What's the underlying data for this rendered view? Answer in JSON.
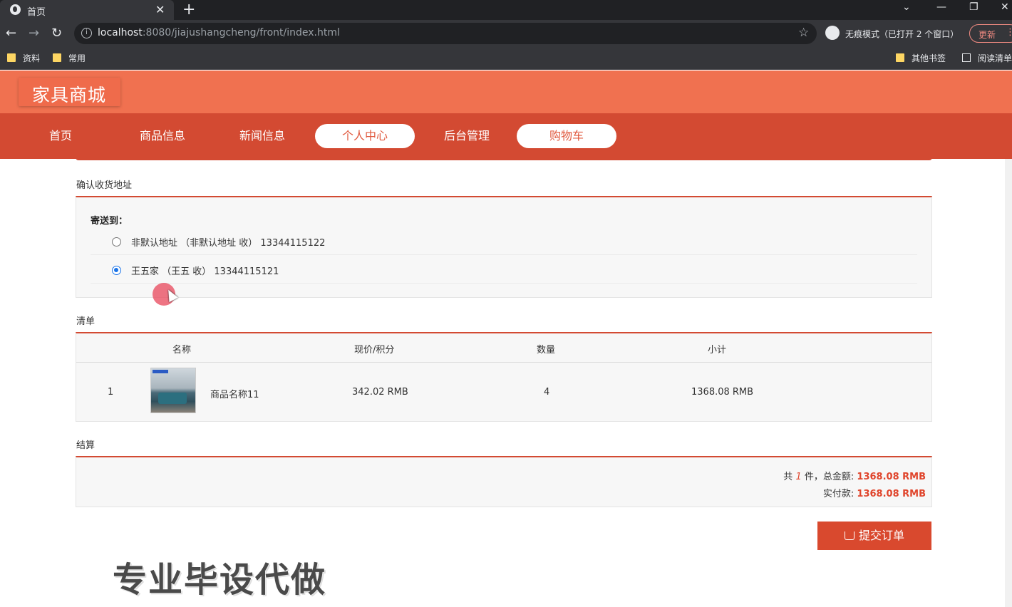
{
  "browser": {
    "tab_title": "首页",
    "url_host": "localhost",
    "url_rest": ":8080/jiajushangcheng/front/index.html",
    "incognito_label": "无痕模式（已打开 2 个窗口）",
    "update_label": "更新",
    "bookmarks": [
      "资料",
      "常用"
    ],
    "bookmarks_right": [
      "其他书签",
      "阅读清单"
    ]
  },
  "site": {
    "logo": "家具商城",
    "nav": [
      "首页",
      "商品信息",
      "新闻信息",
      "个人中心",
      "后台管理",
      "购物车"
    ]
  },
  "address": {
    "section_title": "确认收货地址",
    "ship_to_label": "寄送到：",
    "options": [
      {
        "text": "非默认地址 （非默认地址 收） 13344115122",
        "checked": false
      },
      {
        "text": "王五家 （王五 收） 13344115121",
        "checked": true
      }
    ]
  },
  "list": {
    "section_title": "清单",
    "headers": [
      "名称",
      "现价/积分",
      "数量",
      "小计"
    ],
    "rows": [
      {
        "index": "1",
        "name": "商品名称11",
        "price": "342.02 RMB",
        "qty": "4",
        "subtotal": "1368.08 RMB"
      }
    ]
  },
  "checkout": {
    "section_title": "结算",
    "total_prefix": "共",
    "total_count": "1",
    "total_mid": "件，总金额:",
    "total_amount": "1368.08 RMB",
    "paid_label": "实付款:",
    "paid_amount": "1368.08 RMB",
    "submit_label": "提交订单"
  },
  "watermark": "专业毕设代做",
  "colors": {
    "header": "#f07150",
    "navbar": "#d34a32",
    "accent_red": "#e0452c",
    "selected_radio": "#1a73e8"
  }
}
